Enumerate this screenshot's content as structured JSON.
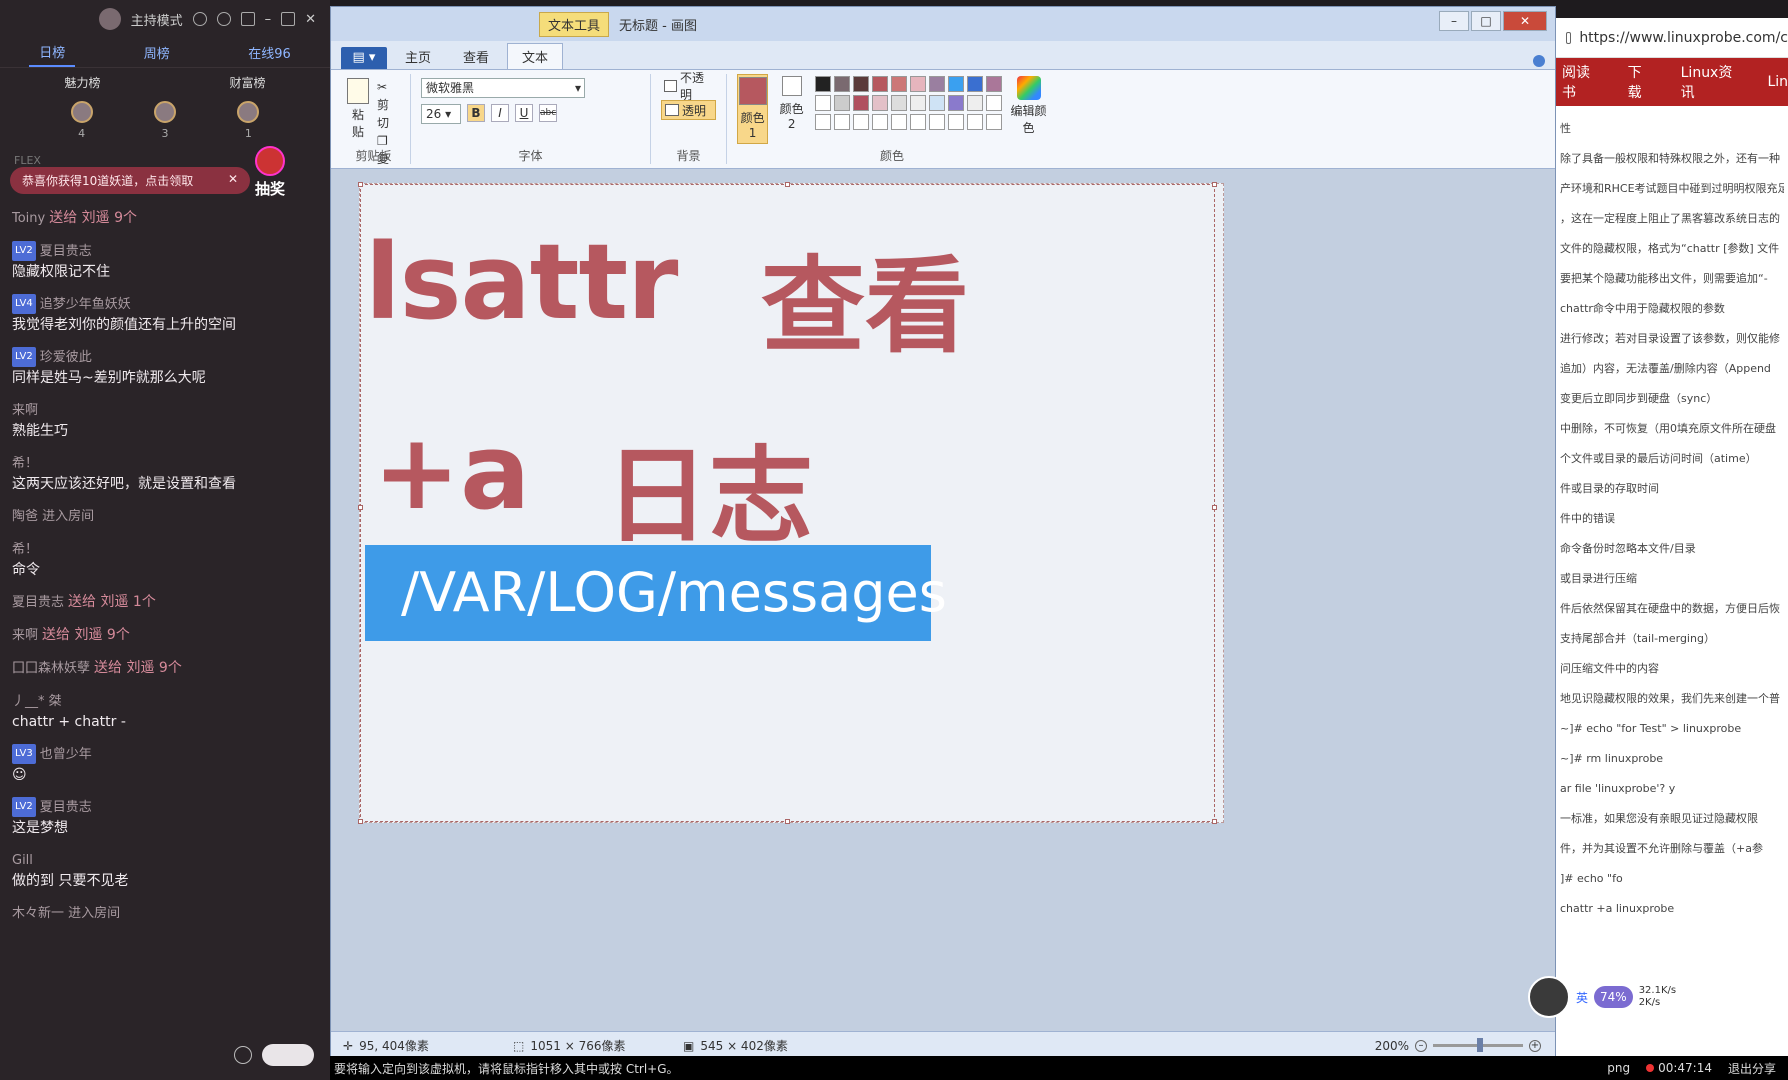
{
  "chat": {
    "mode_label": "主持模式",
    "tabs": [
      "日榜",
      "周榜",
      "在线96"
    ],
    "rank_titles": [
      "魅力榜",
      "财富榜"
    ],
    "rank_counts": [
      "4",
      "3",
      "1"
    ],
    "flex_label": "FLEX",
    "notice": "恭喜你获得10道妖道，点击领取",
    "lottery": "抽奖",
    "messages": [
      {
        "who": "Toiny",
        "gift": "送给 刘遥 9个",
        "lv": "",
        "text": ""
      },
      {
        "who": "夏目贵志",
        "lv": "LV2",
        "text": "隐藏权限记不住"
      },
      {
        "who": "追梦少年鱼妖妖",
        "lv": "LV4",
        "text": "我觉得老刘你的颜值还有上升的空间"
      },
      {
        "who": "珍爱彼此",
        "lv": "LV2",
        "text": "同样是姓马~差别咋就那么大呢"
      },
      {
        "who": "来啊",
        "lv": "",
        "text": "熟能生巧"
      },
      {
        "who": "希！",
        "lv": "",
        "text": "这两天应该还好吧，就是设置和查看"
      },
      {
        "who": "陶爸 进入房间",
        "lv": "",
        "text": ""
      },
      {
        "who": "希！",
        "lv": "",
        "text": "命令"
      },
      {
        "who": "夏目贵志",
        "gift": "送给 刘遥 1个",
        "lv": "",
        "text": ""
      },
      {
        "who": "来啊",
        "gift": "送给 刘遥 9个",
        "lv": "",
        "text": ""
      },
      {
        "who": "囗囗森林妖孽",
        "gift": "送给 刘遥 9个",
        "lv": "",
        "text": ""
      },
      {
        "who": "丿__* 桀",
        "lv": "",
        "text": "chattr +    chattr -"
      },
      {
        "who": "也曾少年",
        "lv": "LV3",
        "text": "☺"
      },
      {
        "who": "夏目贵志",
        "lv": "LV2",
        "text": "这是梦想"
      },
      {
        "who": "Gill",
        "lv": "",
        "text": "做的到 只要不见老"
      },
      {
        "who": "木々新一 进入房间",
        "lv": "",
        "text": ""
      }
    ]
  },
  "paint": {
    "context_tab": "文本工具",
    "doc_title": "无标题 - 画图",
    "win_buttons": [
      "–",
      "□",
      "✕"
    ],
    "tabs": [
      "主页",
      "查看",
      "文本"
    ],
    "clipboard": {
      "paste": "粘贴",
      "cut": "剪切",
      "copy": "复制",
      "label": "剪贴板"
    },
    "font": {
      "family": "微软雅黑",
      "size": "26",
      "label": "字体",
      "fmt": [
        "B",
        "I",
        "U",
        "abc"
      ]
    },
    "background": {
      "opaque": "不透明",
      "transparent": "透明",
      "label": "背景"
    },
    "colors": {
      "color1": "颜色 1",
      "color2": "颜色 2",
      "edit": "编辑颜色",
      "label": "颜色",
      "color1_hex": "#b6585f",
      "color2_hex": "#ffffff"
    },
    "canvas_text": {
      "line1a": "lsattr",
      "line1b": "查看",
      "line2a": "+a",
      "line2b": "日志",
      "highlight": "/VAR/LOG/messages"
    },
    "status": {
      "cursor": "95, 404像素",
      "selection": "1051 × 766像素",
      "size": "545 × 402像素",
      "zoom": "200%"
    }
  },
  "browser": {
    "url": "https://www.linuxprobe.com/c",
    "nav": [
      "阅读书",
      "下载",
      "Linux资讯",
      "Lin"
    ],
    "lines": [
      "性",
      "除了具备一般权限和特殊权限之外，还有一种",
      "产环境和RHCE考试题目中碰到过明明权限充足",
      "，这在一定程度上阻止了黑客篡改系统日志的",
      "文件的隐藏权限，格式为“chattr [参数] 文件",
      "要把某个隐藏功能移出文件，则需要追加“-",
      "chattr命令中用于隐藏权限的参数",
      "进行修改；若对目录设置了该参数，则仅能修",
      "追加）内容，无法覆盖/删除内容（Append",
      "变更后立即同步到硬盘（sync）",
      "中删除，不可恢复（用0填充原文件所在硬盘",
      "个文件或目录的最后访问时间（atime）",
      "件或目录的存取时间",
      "件中的错误",
      "命令备份时忽略本文件/目录",
      "或目录进行压缩",
      "件后依然保留其在硬盘中的数据，方便日后恢",
      "支持尾部合并（tail-merging）",
      "问压缩文件中的内容",
      "地见识隐藏权限的效果，我们先来创建一个普",
      "~]# echo \"for Test\" > linuxprobe",
      "~]# rm linuxprobe",
      "ar file 'linuxprobe'? y",
      "一标准，如果您没有亲眼见证过隐藏权限",
      "件，并为其设置不允许删除与覆盖（+a参",
      "]# echo \"fo",
      "chattr +a linuxprobe"
    ]
  },
  "vm": {
    "hint": "要将输入定向到该虚拟机，请将鼠标指针移入其中或按 Ctrl+G。",
    "file_type": "png",
    "timer": "00:47:14",
    "exit": "退出分享"
  },
  "widget": {
    "percent": "74%",
    "up": "32.1K/s",
    "down": "2K/s",
    "ime": "英"
  }
}
